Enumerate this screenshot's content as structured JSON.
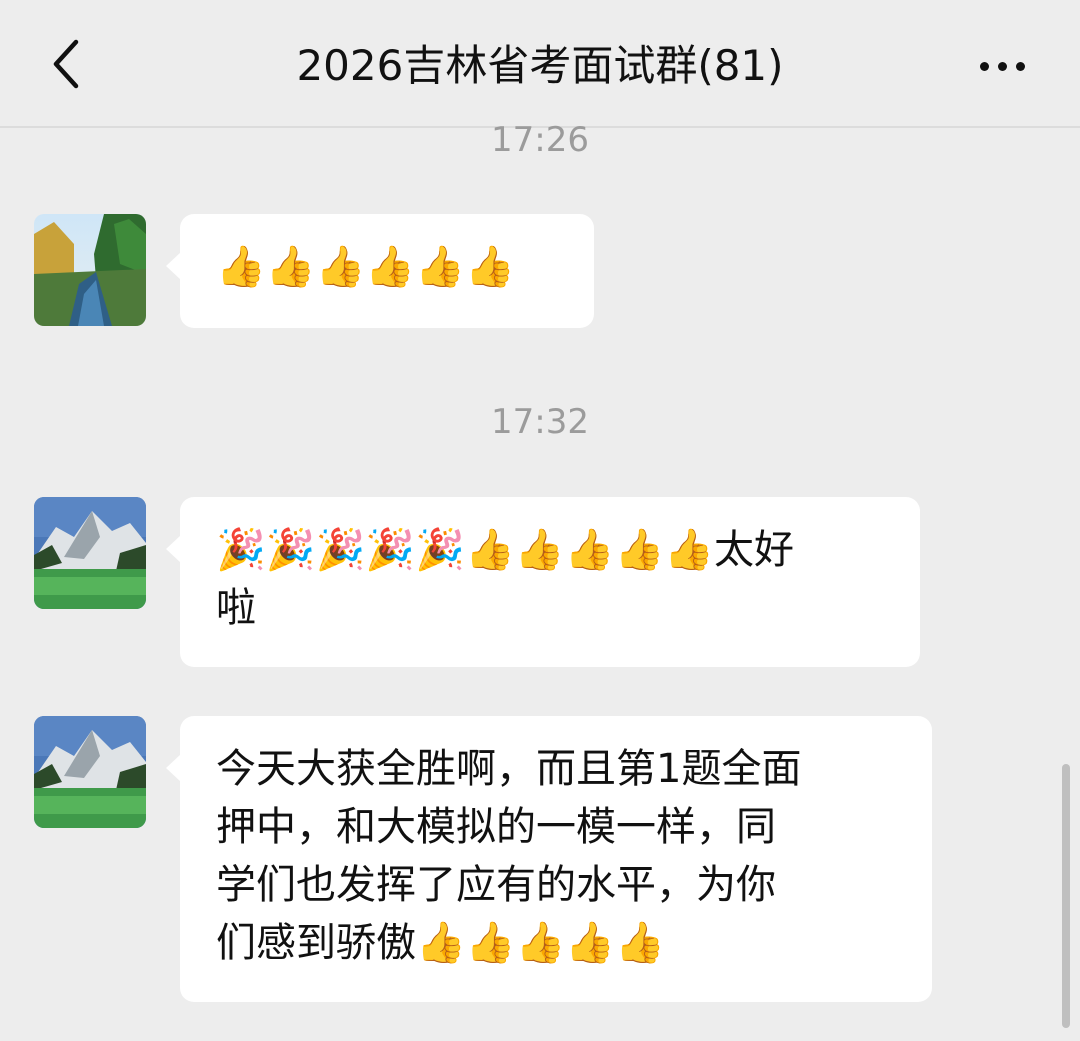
{
  "header": {
    "title": "2026吉林省考面试群(81)",
    "back_icon": "chevron-left-icon",
    "more_icon": "more-horizontal-icon"
  },
  "timestamps": [
    "17:26",
    "17:32"
  ],
  "messages": [
    {
      "text": "👍👍👍👍👍👍"
    },
    {
      "text": "🎉🎉🎉🎉🎉👍👍👍👍👍太好\n啦"
    },
    {
      "text": "今天大获全胜啊，而且第1题全面\n押中，和大模拟的一模一样，同\n学们也发挥了应有的水平，为你\n们感到骄傲👍👍👍👍👍"
    }
  ],
  "colors": {
    "background": "#ededed",
    "bubble": "#ffffff",
    "timestamp": "#9b9b9b"
  }
}
